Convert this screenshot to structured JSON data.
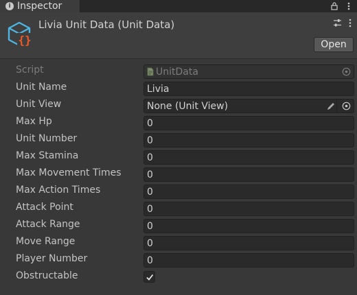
{
  "tab": {
    "label": "Inspector",
    "icon": "info-icon"
  },
  "header": {
    "title": "Livia Unit Data (Unit Data)",
    "open_button": "Open"
  },
  "fields": {
    "script": {
      "label": "Script",
      "value": "UnitData"
    },
    "unit_name": {
      "label": "Unit Name",
      "value": "Livia"
    },
    "unit_view": {
      "label": "Unit View",
      "value": "None (Unit View)"
    },
    "max_hp": {
      "label": "Max Hp",
      "value": "0"
    },
    "unit_number": {
      "label": "Unit Number",
      "value": "0"
    },
    "max_stamina": {
      "label": "Max Stamina",
      "value": "0"
    },
    "max_movement": {
      "label": "Max Movement Times",
      "value": "0"
    },
    "max_action": {
      "label": "Max Action Times",
      "value": "0"
    },
    "attack_point": {
      "label": "Attack Point",
      "value": "0"
    },
    "attack_range": {
      "label": "Attack Range",
      "value": "0"
    },
    "move_range": {
      "label": "Move Range",
      "value": "0"
    },
    "player_number": {
      "label": "Player Number",
      "value": "0"
    },
    "obstructable": {
      "label": "Obstructable",
      "checked": true
    }
  },
  "colors": {
    "background": "#383838",
    "field_bg": "#2a2a2a",
    "accent_cyan": "#4fb4e0",
    "accent_orange": "#f05a28"
  }
}
